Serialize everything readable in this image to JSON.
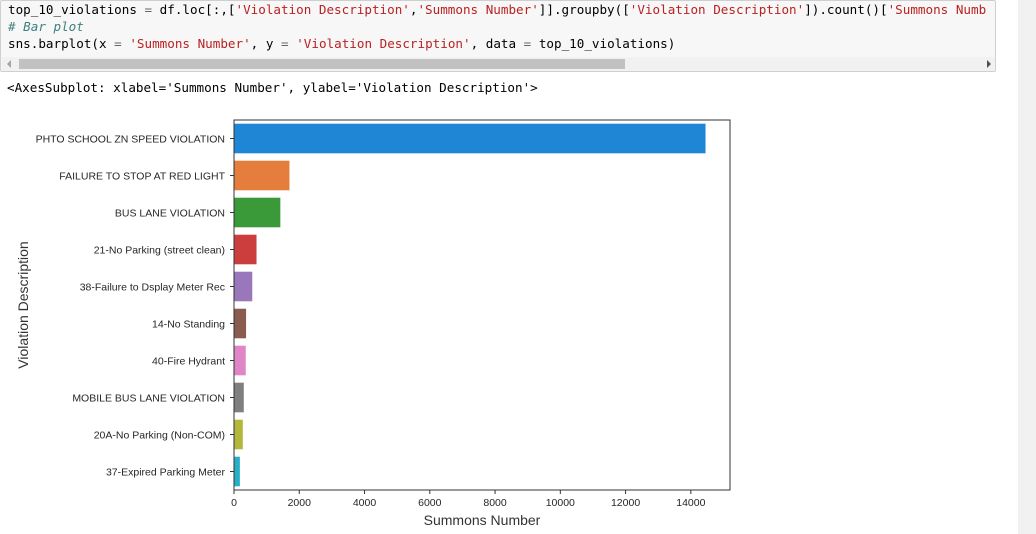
{
  "code_cell": {
    "line1": {
      "var": "top_10_violations",
      "eq": " = ",
      "pre": "df.loc[:,[",
      "s1": "'Violation Description'",
      "comma": ",",
      "s2": "'Summons Number'",
      "mid": "]].groupby([",
      "s3": "'Violation Description'",
      "post": "]).count()[",
      "s4": "'Summons Numb"
    },
    "line2": "# Bar plot",
    "line3": {
      "pre": "sns.barplot(x ",
      "eq1": "=",
      "sp1": " ",
      "s1": "'Summons Number'",
      "mid1": ", y ",
      "eq2": "=",
      "sp2": " ",
      "s2": "'Violation Description'",
      "mid2": ", data ",
      "eq3": "=",
      "post": " top_10_violations)"
    }
  },
  "output_text": "<AxesSubplot: xlabel='Summons Number', ylabel='Violation Description'>",
  "chart_data": {
    "type": "bar",
    "orientation": "horizontal",
    "categories": [
      "PHTO SCHOOL ZN SPEED VIOLATION",
      "FAILURE TO STOP AT RED LIGHT",
      "BUS LANE VIOLATION",
      "21-No Parking (street clean)",
      "38-Failure to Dsplay Meter Rec",
      "14-No Standing",
      "40-Fire Hydrant",
      "MOBILE BUS LANE VIOLATION",
      "20A-No Parking (Non-COM)",
      "37-Expired Parking Meter"
    ],
    "values": [
      14450,
      1700,
      1420,
      690,
      560,
      370,
      360,
      300,
      270,
      180
    ],
    "colors": [
      "#1f86d6",
      "#e57e3c",
      "#3a9a3a",
      "#cc3d3d",
      "#9a76bb",
      "#8a5b4f",
      "#de86c8",
      "#7f7f7f",
      "#b3b83a",
      "#26b0c7"
    ],
    "xlabel": "Summons Number",
    "ylabel": "Violation Description",
    "xlim": [
      0,
      15200
    ],
    "xticks": [
      0,
      2000,
      4000,
      6000,
      8000,
      10000,
      12000,
      14000
    ],
    "grid": false
  }
}
